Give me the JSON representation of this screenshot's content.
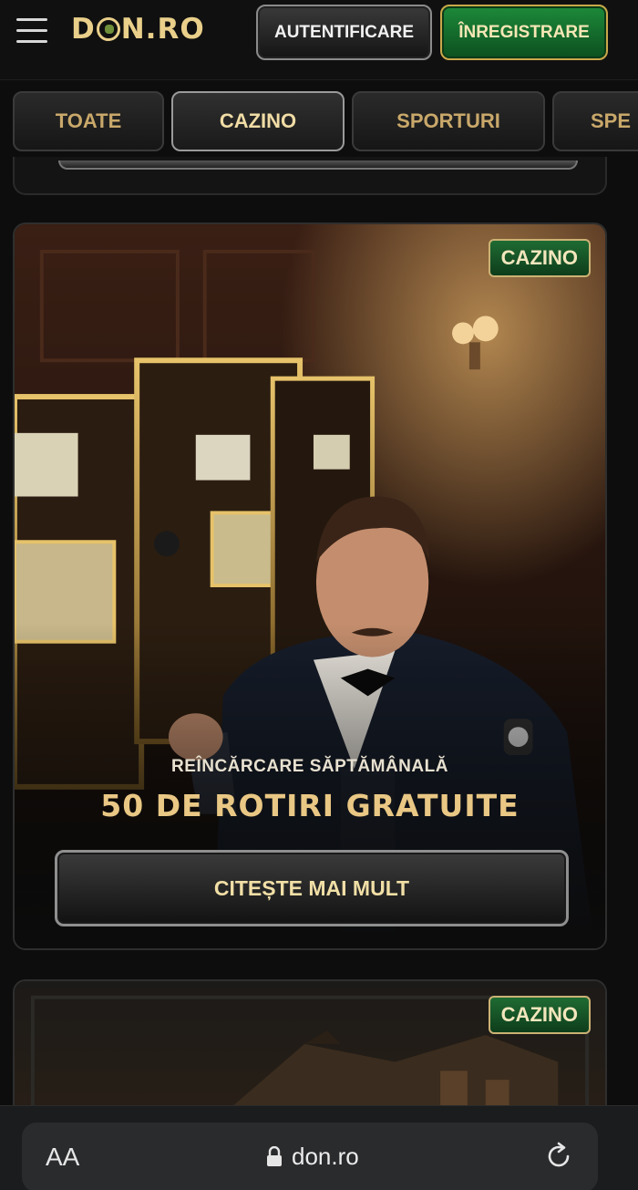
{
  "header": {
    "logo": "DON.RO",
    "login_label": "AUTENTIFICARE",
    "register_label": "ÎNREGISTRARE"
  },
  "tabs": [
    {
      "label": "TOATE",
      "active": false
    },
    {
      "label": "CAZINO",
      "active": true
    },
    {
      "label": "SPORTURI",
      "active": false
    },
    {
      "label": "SPE",
      "active": false
    }
  ],
  "cards": [
    {
      "badge": "CAZINO",
      "subtitle": "REÎNCĂRCARE SĂPTĂMÂNALĂ",
      "title": "50 DE ROTIRI GRATUITE",
      "cta": "CITEȘTE MAI MULT"
    },
    {
      "badge": "CAZINO"
    }
  ],
  "browser": {
    "text_size_label": "AA",
    "url": "don.ro"
  },
  "icons": [
    "menu-icon",
    "globe-icon",
    "lock-icon",
    "reload-icon"
  ],
  "colors": {
    "gold": "#e9c784",
    "green": "#1d8a3a",
    "background": "#0d0d0d"
  }
}
